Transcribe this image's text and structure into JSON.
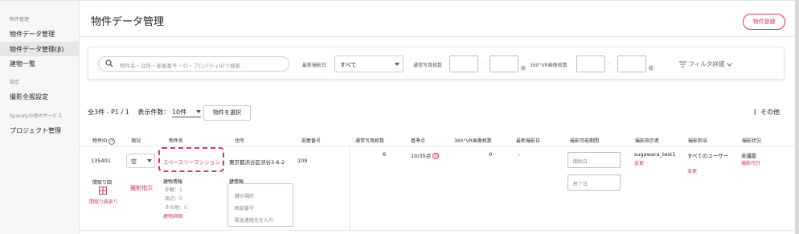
{
  "sidebar": {
    "sections": [
      {
        "label": "物件管理"
      },
      {
        "label": "設定"
      },
      {
        "label": "Spacelyの他のサービス"
      }
    ],
    "items": [
      {
        "label": "物件データ管理"
      },
      {
        "label": "物件データ管理(β)"
      },
      {
        "label": "建物一覧"
      },
      {
        "label": "撮影全般設定"
      },
      {
        "label": "プロジェクト管理"
      }
    ]
  },
  "header": {
    "title": "物件データ管理",
    "register_button": "物件登録"
  },
  "filters": {
    "search_placeholder": "物件名・住所・部屋番号・ID・プロパティIDで検索",
    "latest_date_label": "最新撮影日",
    "latest_date_value": "すべて",
    "normal_photo_label": "通常写真枚数",
    "unit_sheets": "枚",
    "dash": "-",
    "vr_label": "360°VR画像枚数",
    "filter_detail": "フィルタ詳細"
  },
  "list_controls": {
    "summary": "全3件 - P1 / 1",
    "per_page_label": "表示件数：",
    "per_page_value": "10件",
    "select_button": "物件を選択",
    "more_label": "その他"
  },
  "table": {
    "headers": [
      "物件ID",
      "現況",
      "物件名",
      "住所",
      "部屋番号",
      "通常写真枚数",
      "基準点",
      "360°VR画像枚数",
      "最新撮影日",
      "撮影可能期間",
      "撮影指示者",
      "撮影担当",
      "撮影状況"
    ],
    "rows": [
      {
        "id": "135401",
        "status": "空",
        "name": "スペースリーマンション",
        "address": "東京都渋谷区渋谷3-6-2",
        "room": "109",
        "normal_photos": "6",
        "reference": "10/35点",
        "vr_count": "0",
        "latest_date": "-",
        "start_ph": "開始日",
        "end_ph": "終了日",
        "instructor": "sugawara_test1",
        "instructor_change": "変更",
        "assignee": "すべてのユーザー",
        "assignee_change": "変更",
        "shoot_status": "未撮影",
        "shoot_proxy": "撮影代行",
        "floor_plan_label": "間取り図",
        "floor_plan_status": "間取り図あり",
        "shoot_instruction": "撮影指示",
        "building_info_title": "建物情報",
        "building_info_lines": [
          "外観：1",
          "周辺：0",
          "その他：0"
        ],
        "building_detail_link": "建物詳細",
        "key_info_title": "鍵情報",
        "key_info_placeholders": [
          "鍵の場所",
          "解錠番号",
          "緊急連絡先を入力"
        ]
      }
    ]
  }
}
